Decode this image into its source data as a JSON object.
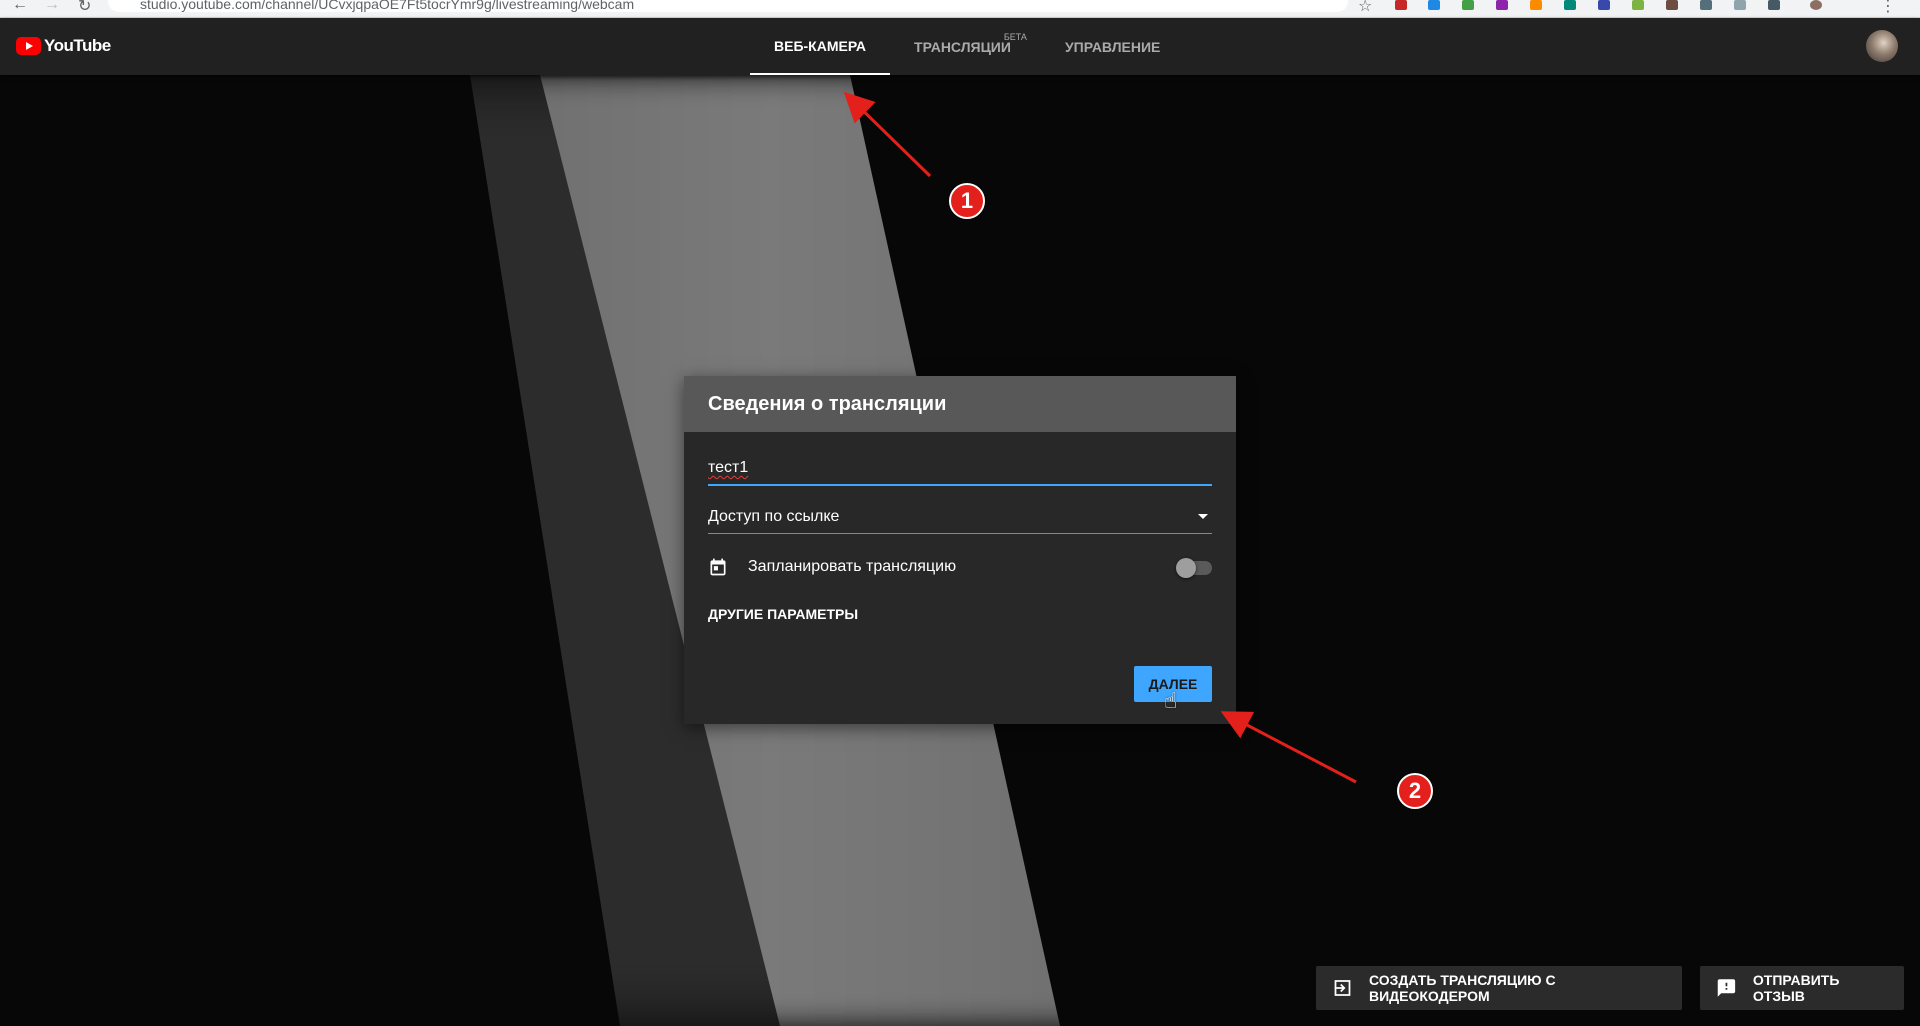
{
  "browser": {
    "url": "studio.youtube.com/channel/UCvxjqpaOE7Ft5tocrYmr9g/livestreaming/webcam"
  },
  "header": {
    "logo_text": "YouTube",
    "tabs": [
      {
        "label": "ВЕБ-КАМЕРА",
        "active": true
      },
      {
        "label": "ТРАНСЛЯЦИИ",
        "badge": "БЕТА",
        "active": false
      },
      {
        "label": "УПРАВЛЕНИЕ",
        "active": false
      }
    ]
  },
  "dialog": {
    "title": "Сведения о трансляции",
    "title_field_value": "тест1",
    "privacy_value": "Доступ по ссылке",
    "schedule_label": "Запланировать трансляцию",
    "schedule_enabled": false,
    "more_params_label": "ДРУГИЕ ПАРАМЕТРЫ",
    "next_label": "ДАЛЕЕ"
  },
  "bottom": {
    "create_encoder_label": "СОЗДАТЬ ТРАНСЛЯЦИЮ С ВИДЕОКОДЕРОМ",
    "feedback_label": "ОТПРАВИТЬ ОТЗЫВ"
  },
  "annotations": {
    "marker1": "1",
    "marker2": "2",
    "color": "#e3201b"
  },
  "colors": {
    "accent_blue": "#3ea6ff",
    "header_bg": "#212121",
    "dialog_header_bg": "#585858",
    "dialog_bg": "#282828"
  }
}
